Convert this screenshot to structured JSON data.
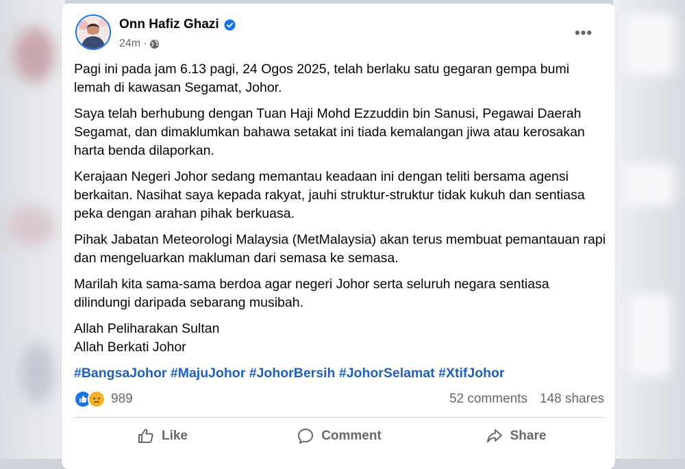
{
  "post": {
    "author": "Onn Hafiz Ghazi",
    "verified_icon": "verified-badge-icon",
    "time": "24m",
    "separator": "·",
    "privacy_icon": "globe-icon",
    "more_icon": "more-options-icon",
    "more_label": "•••",
    "paragraphs": [
      "Pagi ini pada jam 6.13 pagi, 24 Ogos 2025, telah berlaku satu gegaran gempa bumi lemah di kawasan Segamat, Johor.",
      "Saya telah berhubung dengan Tuan Haji Mohd Ezzuddin bin Sanusi, Pegawai Daerah Segamat, dan dimaklumkan bahawa setakat ini tiada kemalangan jiwa atau kerosakan harta benda dilaporkan.",
      "Kerajaan Negeri Johor sedang memantau keadaan ini dengan teliti bersama agensi berkaitan. Nasihat saya kepada rakyat, jauhi struktur-struktur tidak kukuh dan sentiasa peka dengan arahan pihak berkuasa.",
      "Pihak Jabatan Meteorologi Malaysia (MetMalaysia) akan terus membuat pemantauan rapi dan mengeluarkan makluman dari semasa ke semasa.",
      "Marilah kita sama-sama berdoa agar negeri Johor serta seluruh negara sentiasa dilindungi daripada sebarang musibah."
    ],
    "closing_line_1": "Allah Peliharakan Sultan",
    "closing_line_2": "Allah Berkati Johor",
    "hashtags": [
      "#BangsaJohor",
      "#MajuJohor",
      "#JohorBersih",
      "#JohorSelamat",
      "#XtifJohor"
    ]
  },
  "stats": {
    "reaction_icons": [
      "like-icon",
      "sad-icon"
    ],
    "reaction_count": "989",
    "comments": "52 comments",
    "shares": "148 shares"
  },
  "actions": {
    "like_label": "Like",
    "comment_label": "Comment",
    "share_label": "Share"
  },
  "colors": {
    "brand_blue": "#1b74e4",
    "hashtag": "#1f5fbf",
    "secondary_text": "#65676b",
    "sad_reaction": "#f7b125"
  }
}
